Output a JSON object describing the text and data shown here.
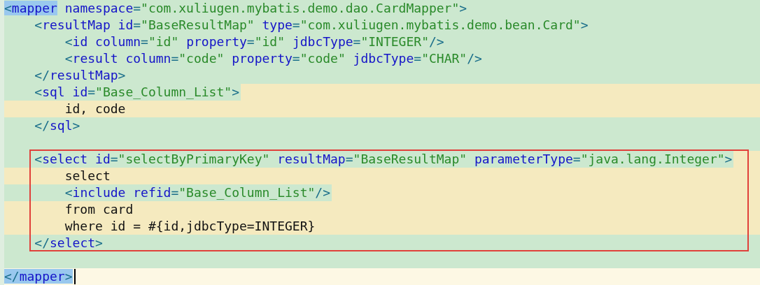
{
  "editor": {
    "lines": [
      {
        "block": false,
        "tokens": [
          {
            "kind": "bracket",
            "text": "<",
            "matched": true
          },
          {
            "kind": "tag",
            "text": "mapper",
            "matched": true
          },
          {
            "kind": "attr",
            "text": " namespace",
            "matched": false
          },
          {
            "kind": "bracket",
            "text": "=",
            "matched": false
          },
          {
            "kind": "value",
            "text": "\"com.xuliugen.mybatis.demo.dao.CardMapper\"",
            "matched": false
          },
          {
            "kind": "bracket",
            "text": ">",
            "matched": false
          }
        ]
      },
      {
        "block": false,
        "tokens": [
          {
            "kind": "bracket",
            "text": "    <"
          },
          {
            "kind": "tag",
            "text": "resultMap"
          },
          {
            "kind": "attr",
            "text": " id"
          },
          {
            "kind": "bracket",
            "text": "="
          },
          {
            "kind": "value",
            "text": "\"BaseResultMap\""
          },
          {
            "kind": "attr",
            "text": " type"
          },
          {
            "kind": "bracket",
            "text": "="
          },
          {
            "kind": "value",
            "text": "\"com.xuliugen.mybatis.demo.bean.Card\""
          },
          {
            "kind": "bracket",
            "text": ">"
          }
        ]
      },
      {
        "block": false,
        "tokens": [
          {
            "kind": "bracket",
            "text": "        <"
          },
          {
            "kind": "tag",
            "text": "id"
          },
          {
            "kind": "attr",
            "text": " column"
          },
          {
            "kind": "bracket",
            "text": "="
          },
          {
            "kind": "value",
            "text": "\"id\""
          },
          {
            "kind": "attr",
            "text": " property"
          },
          {
            "kind": "bracket",
            "text": "="
          },
          {
            "kind": "value",
            "text": "\"id\""
          },
          {
            "kind": "attr",
            "text": " jdbcType"
          },
          {
            "kind": "bracket",
            "text": "="
          },
          {
            "kind": "value",
            "text": "\"INTEGER\""
          },
          {
            "kind": "bracket",
            "text": "/>"
          }
        ]
      },
      {
        "block": false,
        "tokens": [
          {
            "kind": "bracket",
            "text": "        <"
          },
          {
            "kind": "tag",
            "text": "result"
          },
          {
            "kind": "attr",
            "text": " column"
          },
          {
            "kind": "bracket",
            "text": "="
          },
          {
            "kind": "value",
            "text": "\"code\""
          },
          {
            "kind": "attr",
            "text": " property"
          },
          {
            "kind": "bracket",
            "text": "="
          },
          {
            "kind": "value",
            "text": "\"code\""
          },
          {
            "kind": "attr",
            "text": " jdbcType"
          },
          {
            "kind": "bracket",
            "text": "="
          },
          {
            "kind": "value",
            "text": "\"CHAR\""
          },
          {
            "kind": "bracket",
            "text": "/>"
          }
        ]
      },
      {
        "block": false,
        "tokens": [
          {
            "kind": "bracket",
            "text": "    </"
          },
          {
            "kind": "tag",
            "text": "resultMap"
          },
          {
            "kind": "bracket",
            "text": ">"
          }
        ]
      },
      {
        "block": true,
        "tag_line": true,
        "tokens": [
          {
            "kind": "bracket",
            "text": "    <"
          },
          {
            "kind": "tag",
            "text": "sql"
          },
          {
            "kind": "attr",
            "text": " id"
          },
          {
            "kind": "bracket",
            "text": "="
          },
          {
            "kind": "value",
            "text": "\"Base_Column_List\""
          },
          {
            "kind": "bracket",
            "text": ">"
          }
        ]
      },
      {
        "block": true,
        "tag_line": false,
        "tokens": [
          {
            "kind": "plain",
            "text": "        id, code"
          }
        ]
      },
      {
        "block": false,
        "tokens": [
          {
            "kind": "bracket",
            "text": "    </"
          },
          {
            "kind": "tag",
            "text": "sql"
          },
          {
            "kind": "bracket",
            "text": ">"
          }
        ]
      },
      {
        "block": false
      },
      {
        "kind": "framed_block",
        "lines": [
          {
            "block": true,
            "tag_line": true,
            "tokens": [
              {
                "kind": "bracket",
                "text": "    <"
              },
              {
                "kind": "tag",
                "text": "select"
              },
              {
                "kind": "attr",
                "text": " id"
              },
              {
                "kind": "bracket",
                "text": "="
              },
              {
                "kind": "value",
                "text": "\"selectByPrimaryKey\""
              },
              {
                "kind": "attr",
                "text": " resultMap"
              },
              {
                "kind": "bracket",
                "text": "="
              },
              {
                "kind": "value",
                "text": "\"BaseResultMap\""
              },
              {
                "kind": "attr",
                "text": " parameterType"
              },
              {
                "kind": "bracket",
                "text": "="
              },
              {
                "kind": "value",
                "text": "\"java.lang.Integer\""
              },
              {
                "kind": "bracket",
                "text": ">"
              }
            ]
          },
          {
            "block": true,
            "tag_line": false,
            "tokens": [
              {
                "kind": "plain",
                "text": "        select"
              }
            ]
          },
          {
            "block": true,
            "tag_line": true,
            "tokens": [
              {
                "kind": "bracket",
                "text": "        <"
              },
              {
                "kind": "tag",
                "text": "include"
              },
              {
                "kind": "attr",
                "text": " refid"
              },
              {
                "kind": "bracket",
                "text": "="
              },
              {
                "kind": "value",
                "text": "\"Base_Column_List\""
              },
              {
                "kind": "bracket",
                "text": "/>"
              }
            ]
          },
          {
            "block": true,
            "tag_line": false,
            "tokens": [
              {
                "kind": "plain",
                "text": "        from card"
              }
            ]
          },
          {
            "block": true,
            "tag_line": false,
            "tokens": [
              {
                "kind": "plain",
                "text": "        where id = #{id,jdbcType=INTEGER}"
              }
            ]
          },
          {
            "block": false,
            "tokens": [
              {
                "kind": "bracket",
                "text": "    </"
              },
              {
                "kind": "tag",
                "text": "select"
              },
              {
                "kind": "bracket",
                "text": ">"
              }
            ]
          }
        ]
      },
      {
        "block": false
      },
      {
        "current": true,
        "tokens": [
          {
            "kind": "bracket",
            "text": "</",
            "matched": true
          },
          {
            "kind": "tag",
            "text": "mapper",
            "matched": true
          },
          {
            "kind": "bracket",
            "text": ">",
            "matched": true
          }
        ]
      }
    ]
  }
}
